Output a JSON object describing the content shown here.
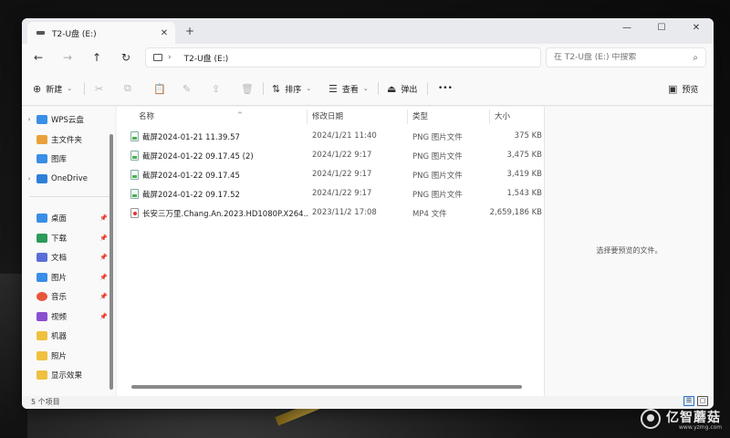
{
  "window": {
    "tab_title": "T2-U盘 (E:)",
    "tab_close": "✕",
    "new_tab": "+",
    "controls": {
      "minimize": "—",
      "maximize": "☐",
      "close": "✕"
    }
  },
  "nav": {
    "back": "←",
    "forward": "→",
    "up": "↑",
    "refresh": "↻",
    "address_chevron": "›",
    "address_crumb": "T2-U盘 (E:)",
    "search_placeholder": "在 T2-U盘 (E:) 中搜索",
    "search_icon": "search-icon"
  },
  "toolbar": {
    "new_label": "新建",
    "new_icon": "⊕",
    "cut_icon": "✂",
    "copy_icon": "⧉",
    "paste_icon": "📋",
    "rename_icon": "✎",
    "share_icon": "⇪",
    "delete_icon": "🗑",
    "sort_label": "排序",
    "sort_icon": "⇅",
    "view_label": "查看",
    "view_icon": "☰",
    "eject_label": "弹出",
    "eject_icon": "⏏",
    "more": "•••",
    "preview_label": "预览",
    "preview_icon": "▣",
    "dropdown": "⌄"
  },
  "sidebar": {
    "expand_arrow": "›",
    "pin": "📌",
    "items": [
      {
        "label": "WPS云盘",
        "color": "#3a8ee6"
      },
      {
        "label": "主文件夹",
        "color": "#e9a23b"
      },
      {
        "label": "图库",
        "color": "#3a8ee6"
      },
      {
        "label": "OneDrive",
        "color": "#2f7fd8"
      },
      {
        "label": "桌面",
        "color": "#3a8ee6"
      },
      {
        "label": "下载",
        "color": "#2f9a5a"
      },
      {
        "label": "文档",
        "color": "#5a6fd6"
      },
      {
        "label": "图片",
        "color": "#3a8ee6"
      },
      {
        "label": "音乐",
        "color": "#e8563a"
      },
      {
        "label": "视频",
        "color": "#8a4fd0"
      },
      {
        "label": "机器",
        "color": "#f0c040"
      },
      {
        "label": "照片",
        "color": "#f0c040"
      },
      {
        "label": "显示效果",
        "color": "#f0c040"
      }
    ]
  },
  "files": {
    "sort_arrow": "^",
    "columns": {
      "name": "名称",
      "date": "修改日期",
      "type": "类型",
      "size": "大小"
    },
    "rows": [
      {
        "name": "截屏2024-01-21 11.39.57",
        "date": "2024/1/21 11:40",
        "type": "PNG 图片文件",
        "size": "375 KB",
        "kind": "png"
      },
      {
        "name": "截屏2024-01-22 09.17.45 (2)",
        "date": "2024/1/22 9:17",
        "type": "PNG 图片文件",
        "size": "3,475 KB",
        "kind": "png"
      },
      {
        "name": "截屏2024-01-22 09.17.45",
        "date": "2024/1/22 9:17",
        "type": "PNG 图片文件",
        "size": "3,419 KB",
        "kind": "png"
      },
      {
        "name": "截屏2024-01-22 09.17.52",
        "date": "2024/1/22 9:17",
        "type": "PNG 图片文件",
        "size": "1,543 KB",
        "kind": "png"
      },
      {
        "name": "长安三万里.Chang.An.2023.HD1080P.X264...",
        "date": "2023/11/2 17:08",
        "type": "MP4 文件",
        "size": "2,659,186 KB",
        "kind": "mp4"
      }
    ]
  },
  "preview": {
    "message": "选择要预览的文件。"
  },
  "status": {
    "count": "5 个项目",
    "details_view": "☰",
    "tiles_view": "▢"
  },
  "watermark": {
    "cn": "亿智蘑菇",
    "en": "www.yzmg.com"
  }
}
